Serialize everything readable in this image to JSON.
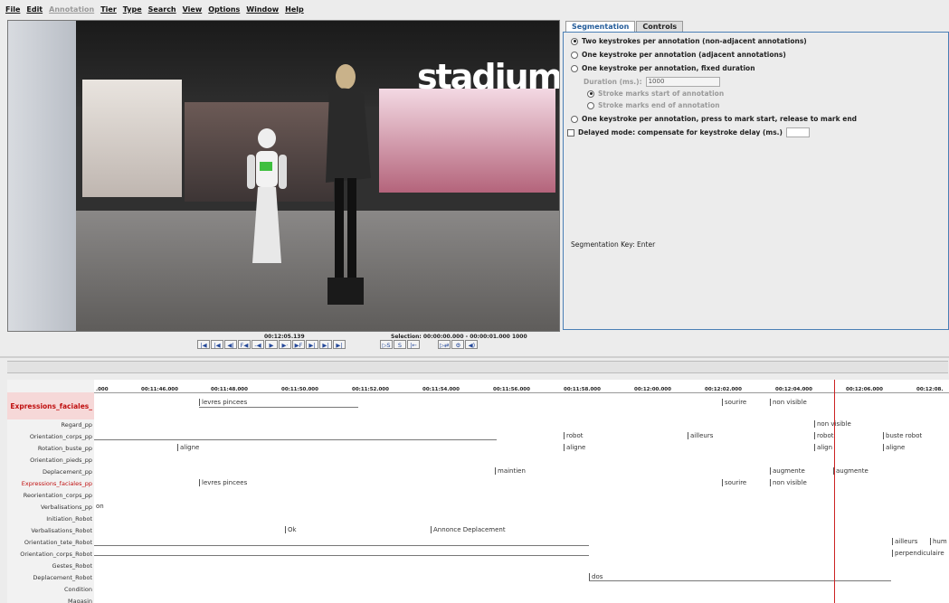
{
  "menu": [
    "File",
    "Edit",
    "Annotation",
    "Tier",
    "Type",
    "Search",
    "View",
    "Options",
    "Window",
    "Help"
  ],
  "video": {
    "sign_text": "stadium"
  },
  "panel": {
    "tabs": [
      "Segmentation",
      "Controls"
    ],
    "options": [
      "Two keystrokes per annotation (non-adjacent annotations)",
      "One keystroke per annotation (adjacent annotations)",
      "One keystroke per annotation, fixed duration"
    ],
    "duration_label": "Duration (ms.):",
    "duration_value": "1000",
    "stroke_start": "Stroke marks start of annotation",
    "stroke_end": "Stroke marks end of annotation",
    "press_release": "One keystroke per annotation, press to mark start, release to mark end",
    "delayed": "Delayed mode: compensate for keystroke delay (ms.)",
    "seg_key": "Segmentation Key:  Enter"
  },
  "player": {
    "current_time": "00:12:05.139",
    "selection": "Selection: 00:00:00.000 - 00:00:01.000  1000",
    "buttons": [
      "|◀",
      "|◀",
      "◀|",
      "F◀",
      "-◀",
      "▶",
      "▶·",
      "▶F",
      "▶|",
      "▶|",
      "▶|"
    ],
    "sel_buttons": [
      "▷S",
      "S",
      "|←"
    ],
    "extra_buttons": [
      "▷⇄",
      "⚙",
      "◀)"
    ]
  },
  "ruler": [
    ".000",
    "00:11:46.000",
    "00:11:48.000",
    "00:11:50.000",
    "00:11:52.000",
    "00:11:54.000",
    "00:11:56.000",
    "00:11:58.000",
    "00:12:00.000",
    "00:12:02.000",
    "00:12:04.000",
    "00:12:06.000",
    "00:12:08."
  ],
  "active_tier": "Expressions_faciales_",
  "top_ann": [
    "levres pincees",
    "sourire",
    "non visible"
  ],
  "tiers": [
    "Regard_pp",
    "Orientation_corps_pp",
    "Rotation_buste_pp",
    "Orientation_pieds_pp",
    "Deplacement_pp",
    "Expressions_faciales_pp",
    "Reorientation_corps_pp",
    "Verbalisations_pp",
    "Initiation_Robot",
    "Verbalisations_Robot",
    "Orientation_tete_Robot",
    "Orientation_corps_Robot",
    "Gestes_Robot",
    "Deplacement_Robot",
    "Condition",
    "Magasin"
  ],
  "annotations": {
    "a0": "non visible",
    "a1": "robot",
    "a2": "robot",
    "a3": "ailleurs",
    "a4": "buste robot",
    "a5": "aligne",
    "a6": "aligne",
    "a7": "align",
    "a8": "aligne",
    "a9": "maintien",
    "a10": "augmente",
    "a11": "augmente",
    "a12": "levres pincees",
    "a13": "sourire",
    "a14": "non visible",
    "a15": "on",
    "a16": "Ok",
    "a17": "Annonce Deplacement",
    "a18": "ailleurs",
    "a19": "hum",
    "a20": "perpendiculaire",
    "a21": "dos"
  }
}
